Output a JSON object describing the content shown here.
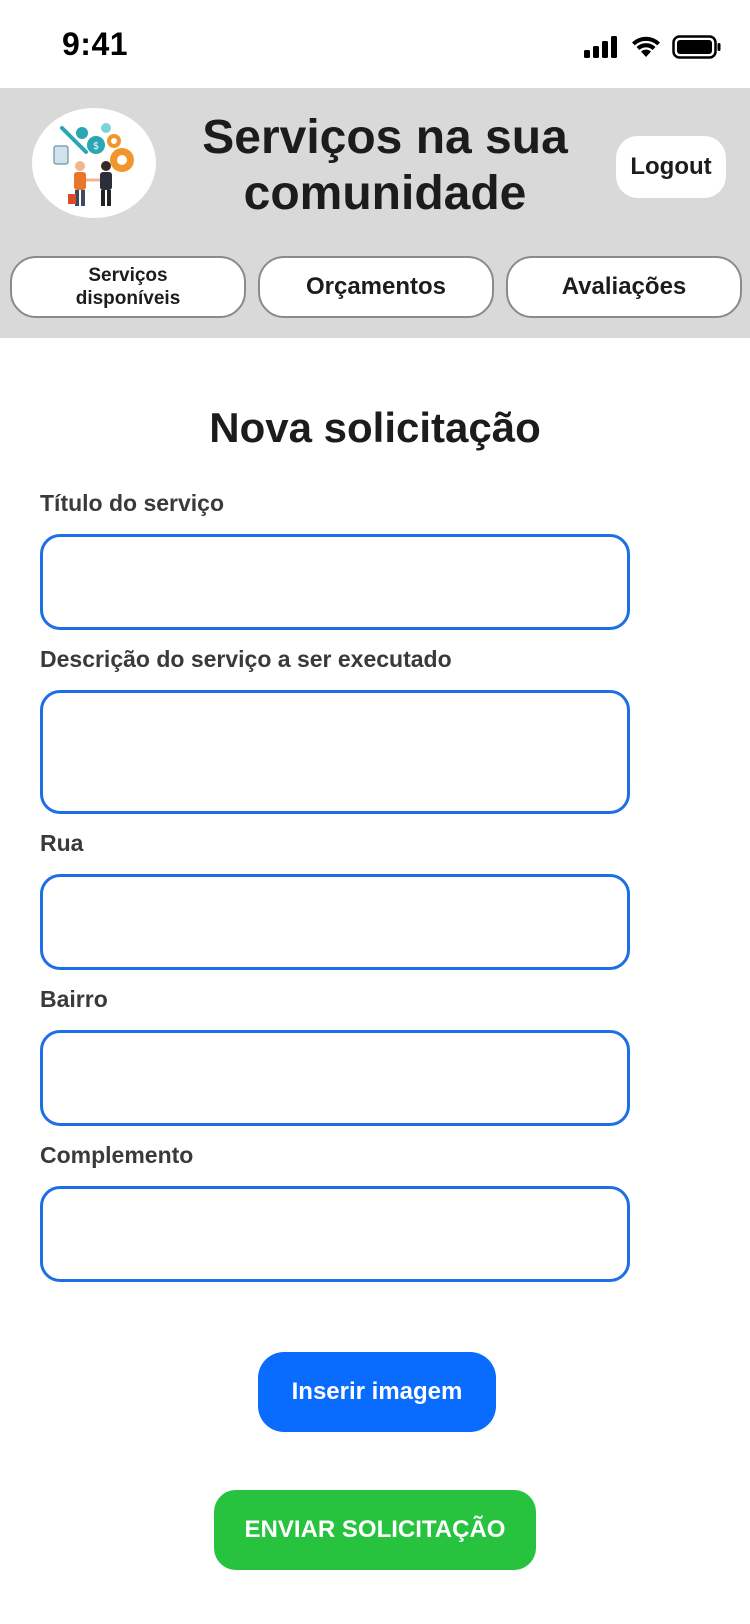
{
  "status_bar": {
    "time": "9:41",
    "icons": [
      "cellular-signal-icon",
      "wifi-icon",
      "battery-icon"
    ]
  },
  "header": {
    "title": "Serviços na sua comunidade",
    "logout_label": "Logout",
    "logo_icon": "community-services-logo"
  },
  "nav": {
    "tabs": [
      {
        "label": "Serviços disponíveis"
      },
      {
        "label": "Orçamentos"
      },
      {
        "label": "Avaliações"
      }
    ]
  },
  "form": {
    "title": "Nova solicitação",
    "fields": [
      {
        "label": "Título do serviço",
        "value": "",
        "placeholder": ""
      },
      {
        "label": "Descrição do serviço a ser executado",
        "value": "",
        "placeholder": ""
      },
      {
        "label": "Rua",
        "value": "",
        "placeholder": ""
      },
      {
        "label": "Bairro",
        "value": "",
        "placeholder": ""
      },
      {
        "label": "Complemento",
        "value": "",
        "placeholder": ""
      }
    ],
    "insert_image_label": "Inserir imagem",
    "submit_label": "ENVIAR SOLICITAÇÃO"
  },
  "colors": {
    "header_bg": "#d9d9d9",
    "input_border": "#1e6ee8",
    "primary_button": "#0a6cff",
    "submit_button": "#27c33f"
  }
}
